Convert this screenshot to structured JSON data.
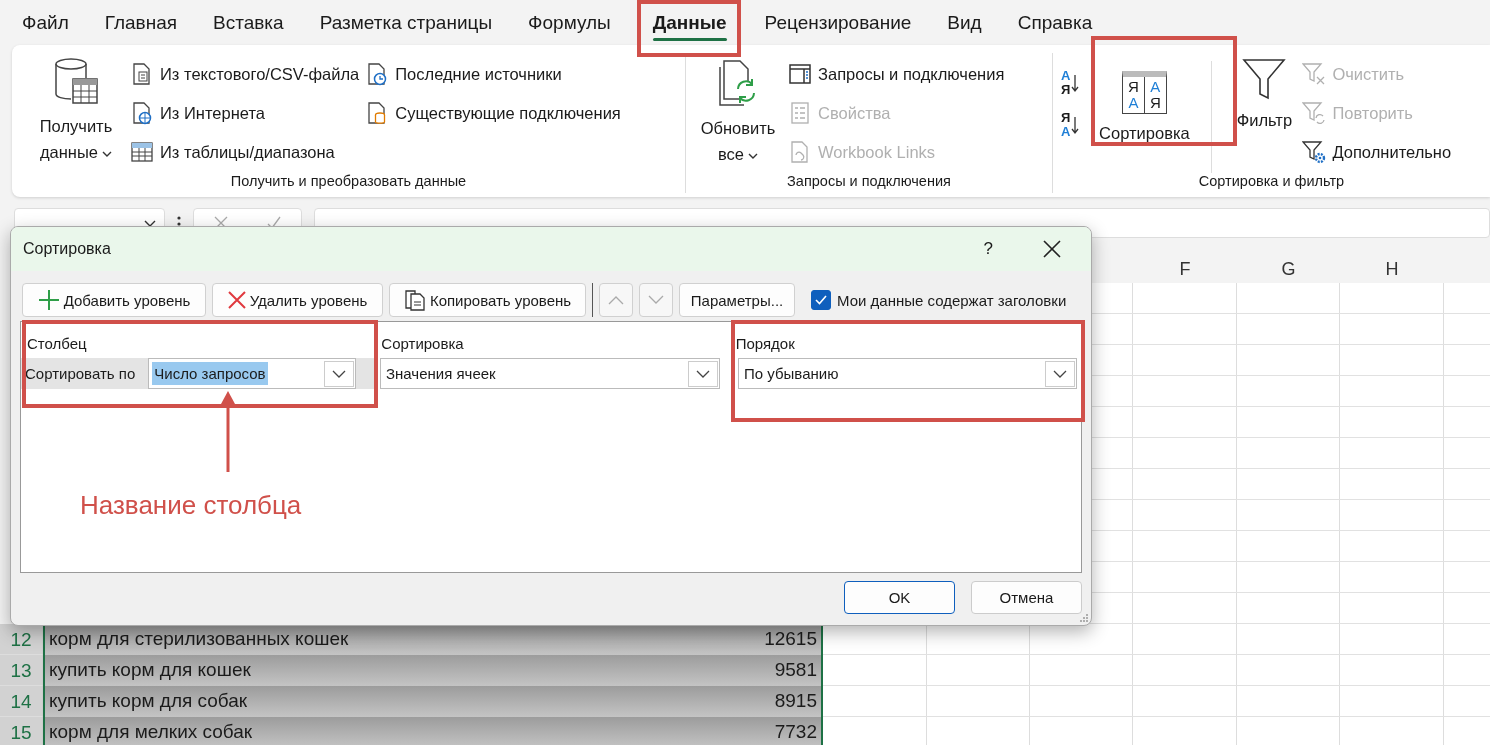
{
  "menu_tabs": [
    {
      "label": "Файл",
      "selected": false
    },
    {
      "label": "Главная",
      "selected": false
    },
    {
      "label": "Вставка",
      "selected": false
    },
    {
      "label": "Разметка страницы",
      "selected": false
    },
    {
      "label": "Формулы",
      "selected": false
    },
    {
      "label": "Данные",
      "selected": true
    },
    {
      "label": "Рецензирование",
      "selected": false
    },
    {
      "label": "Вид",
      "selected": false
    },
    {
      "label": "Справка",
      "selected": false
    }
  ],
  "ribbon": {
    "get_transform": {
      "label": "Получить и преобразовать данные",
      "get_data": "Получить данные",
      "from_text": "Из текстового/CSV-файла",
      "from_web": "Из Интернета",
      "from_table": "Из таблицы/диапазона",
      "recent_sources": "Последние источники",
      "existing_connections": "Существующие подключения"
    },
    "queries": {
      "label": "Запросы и подключения",
      "refresh_all": "Обновить все",
      "queries_connections": "Запросы и подключения",
      "properties": {
        "label": "Свойства",
        "disabled": true
      },
      "workbook_links": {
        "label": "Workbook Links",
        "disabled": true
      }
    },
    "sort_filter": {
      "label": "Сортировка и фильтр",
      "ascending_letters": [
        "А",
        "Я"
      ],
      "descending_letters": [
        "Я",
        "А"
      ],
      "sort_icon_letters": [
        "Я",
        "А",
        "А",
        "Я"
      ],
      "sort": "Сортировка",
      "filter": "Фильтр",
      "clear": {
        "label": "Очистить",
        "disabled": true
      },
      "reapply": {
        "label": "Повторить",
        "disabled": true
      },
      "advanced": {
        "label": "Дополнительно",
        "disabled": false
      }
    }
  },
  "sheet": {
    "column_headers": [
      "F",
      "G",
      "H"
    ],
    "rows": [
      {
        "number": "12",
        "column_a": "корм для стерилизованных кошек",
        "column_b": "12615",
        "selected": true
      },
      {
        "number": "13",
        "column_a": "купить корм для кошек",
        "column_b": "9581",
        "selected": true
      },
      {
        "number": "14",
        "column_a": "купить корм для собак",
        "column_b": "8915",
        "selected": true
      },
      {
        "number": "15",
        "column_a": "корм для мелких собак",
        "column_b": "7732",
        "selected": true
      }
    ]
  },
  "dialog": {
    "title": "Сортировка",
    "help": "?",
    "toolbar": {
      "add_level": "Добавить уровень",
      "delete_level": "Удалить уровень",
      "copy_level": "Копировать уровень",
      "options": "Параметры...",
      "has_headers": {
        "label": "Мои данные содержат заголовки",
        "checked": true
      }
    },
    "headers": {
      "column": "Столбец",
      "sort_on": "Сортировка",
      "order": "Порядок"
    },
    "levels": [
      {
        "label": "Сортировать по",
        "column": "Число запросов",
        "sort_on": "Значения ячеек",
        "order": "По убыванию",
        "selected": true
      }
    ],
    "buttons": [
      {
        "label": "OK",
        "default": true
      },
      {
        "label": "Отмена",
        "default": false
      }
    ]
  },
  "annotation": {
    "text": "Название столбца"
  }
}
